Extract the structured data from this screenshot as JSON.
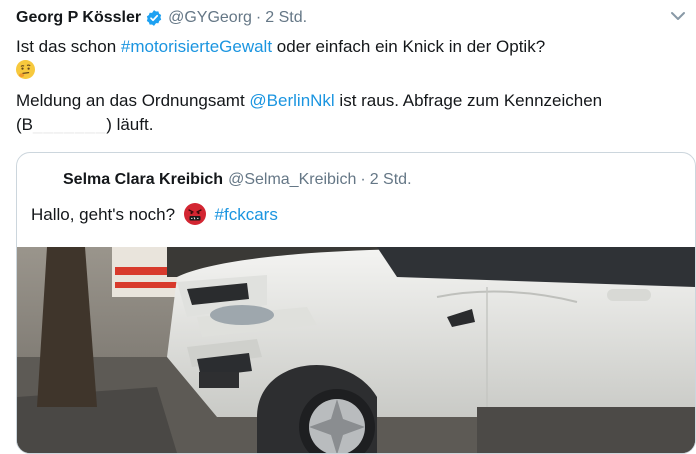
{
  "tweet": {
    "author_name": "Georg P Kössler",
    "author_handle": "@GYGeorg",
    "separator": "·",
    "time": "2 Std.",
    "line1_pre": "Ist das schon ",
    "hashtag1": "#motorisierteGewalt",
    "line1_post": " oder einfach ein Knick in der Optik?",
    "emoji1": "thinking-face-emoji",
    "line2_pre": "Meldung an das Ordnungsamt ",
    "mention": "@BerlinNkl",
    "line2_post": " ist raus. Abfrage zum Kennzeichen (B",
    "redacted": "_______",
    "line2_end": ") läuft."
  },
  "quoted": {
    "author_name": "Selma Clara Kreibich",
    "author_handle": "@Selma_Kreibich",
    "separator": "·",
    "time": "2 Std.",
    "text_pre": "Hallo, geht's noch?",
    "emoji": "angry-face-emoji",
    "hashtag": "#fckcars",
    "photo": "photo of white SUV parked on sidewalk"
  },
  "colors": {
    "link": "#1b95e0",
    "secondary_text": "#657786",
    "border": "#ccd6dd",
    "verified": "#1da1f2"
  }
}
